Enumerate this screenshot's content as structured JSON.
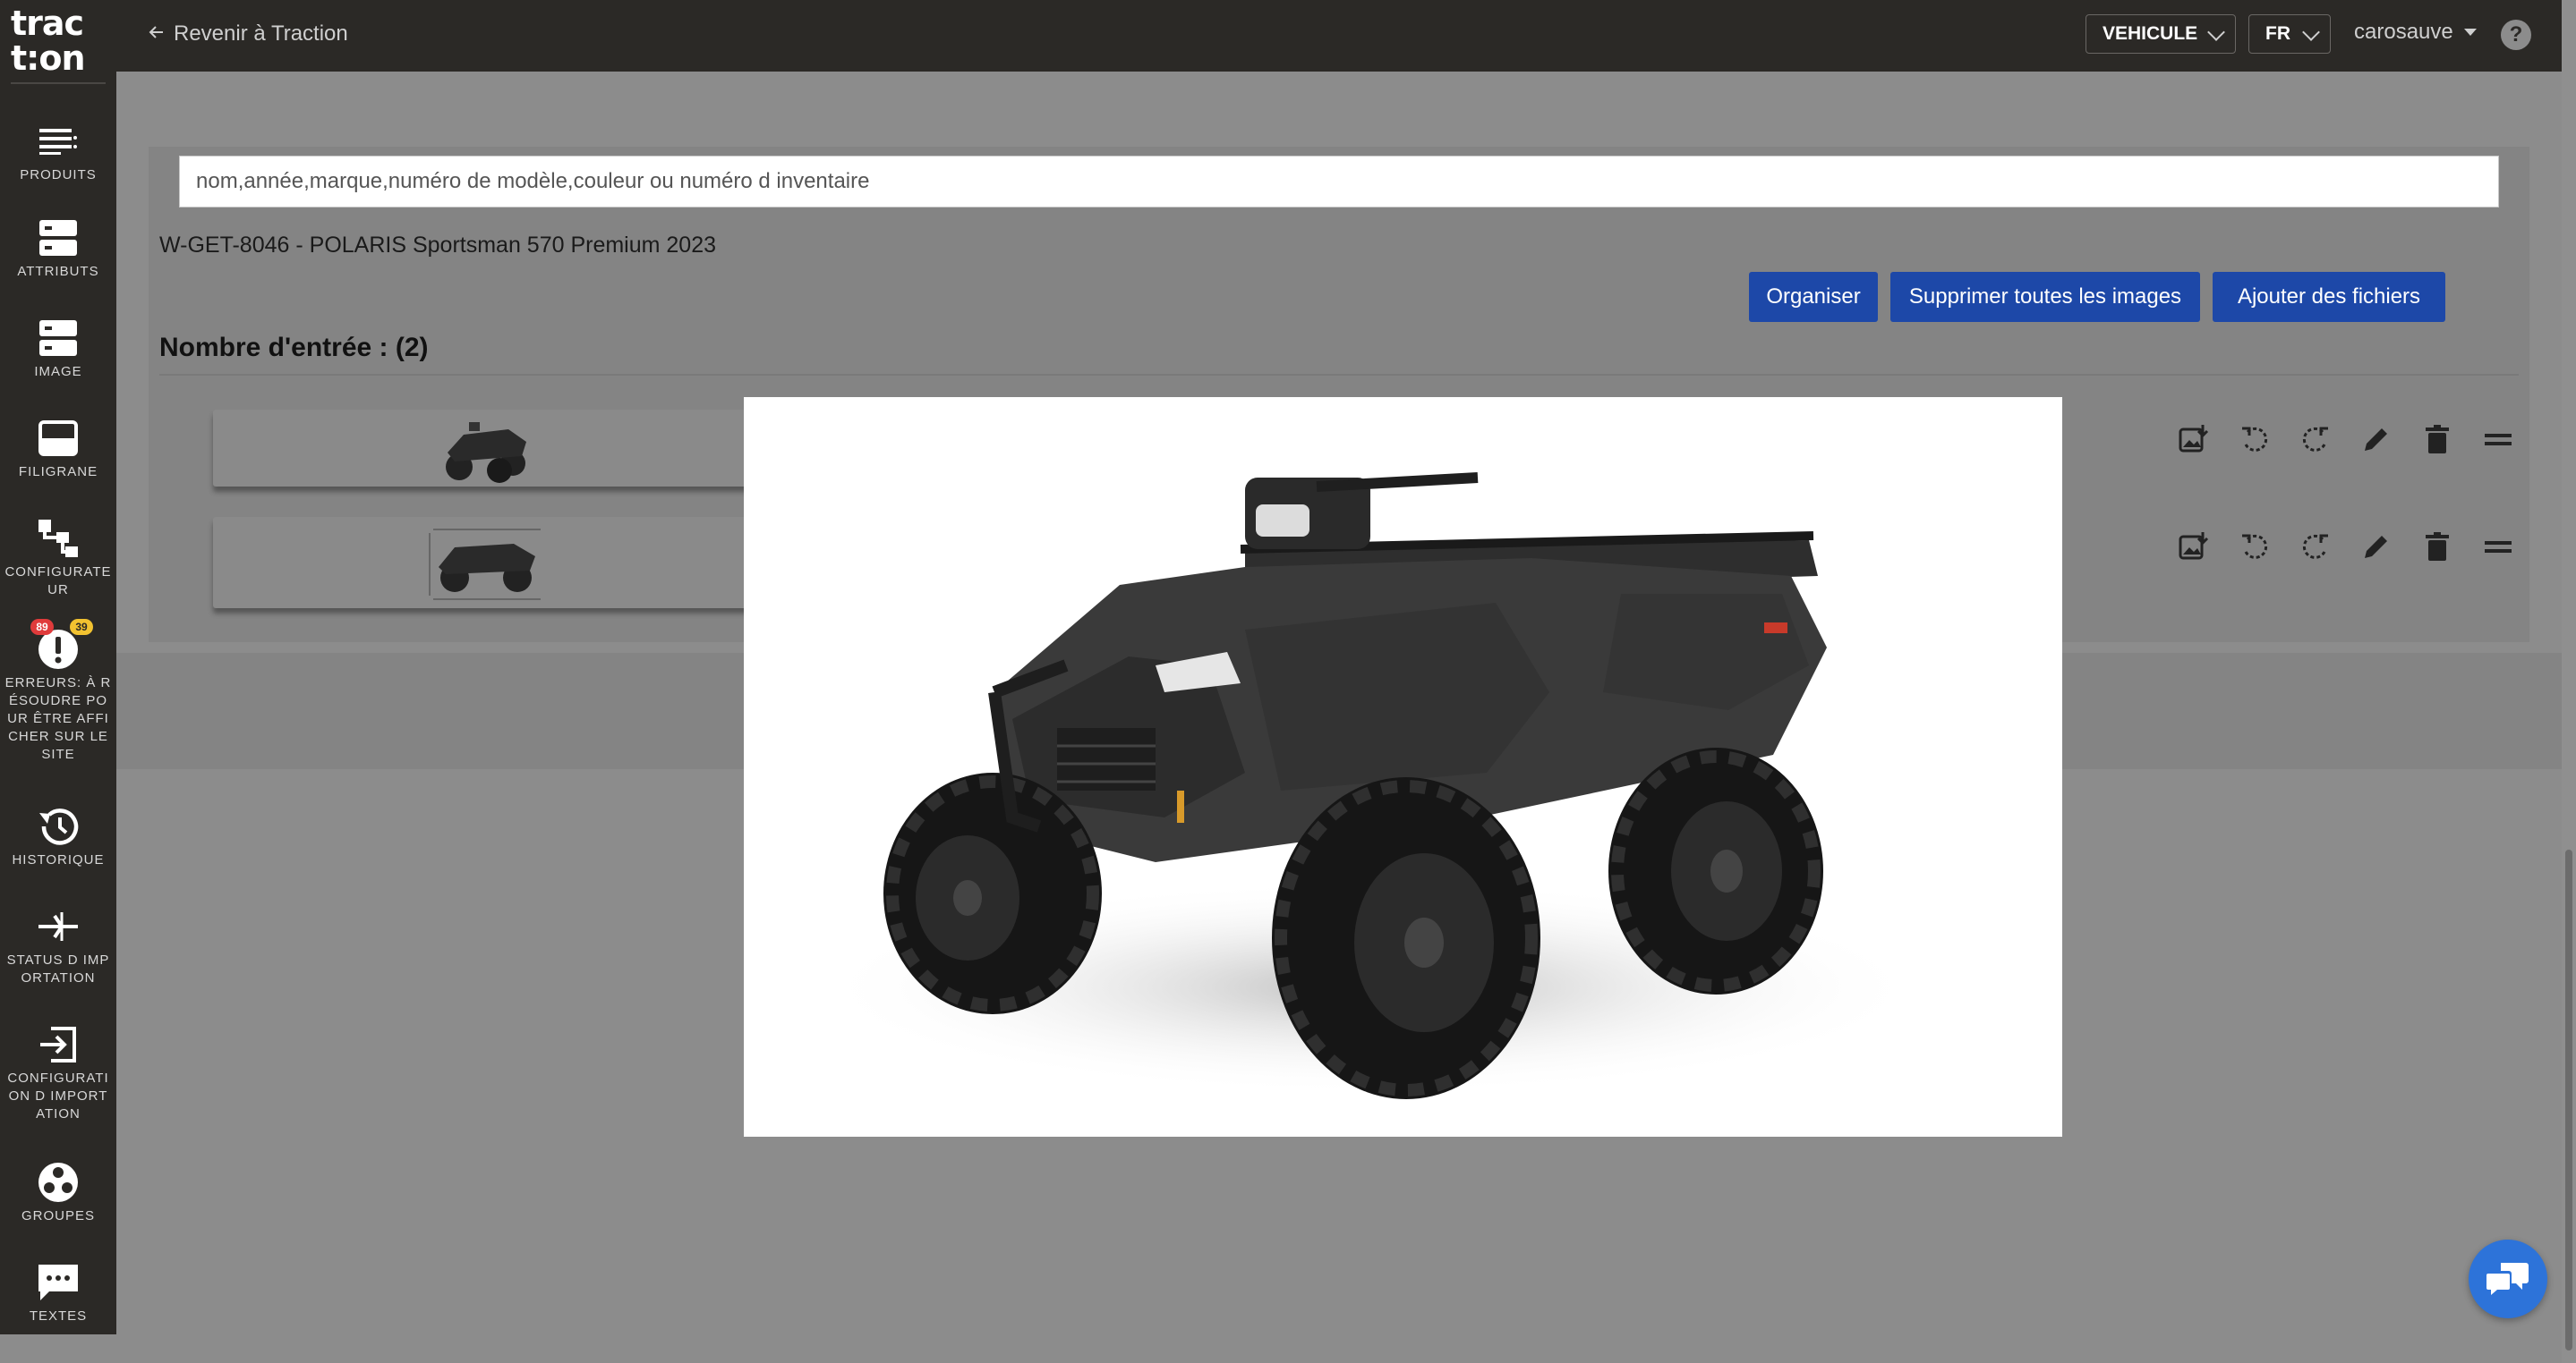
{
  "logo": {
    "line1": "trac",
    "line2": "t:on"
  },
  "sidebar": {
    "items": [
      {
        "id": "produits",
        "label": "PRODUITS",
        "icon": "list-icon"
      },
      {
        "id": "attributs",
        "label": "ATTRIBUTS",
        "icon": "server-icon"
      },
      {
        "id": "image",
        "label": "IMAGE",
        "icon": "server-icon"
      },
      {
        "id": "filigrane",
        "label": "FILIGRANE",
        "icon": "watermark-icon"
      },
      {
        "id": "configurateur",
        "label": "CONFIGURATEUR",
        "icon": "hierarchy-icon"
      },
      {
        "id": "erreurs",
        "label": "ERREURS: À RÉSOUDRE POUR ÊTRE AFFICHER SUR LE SITE",
        "icon": "alert-icon",
        "badge_red": "89",
        "badge_yellow": "39"
      },
      {
        "id": "historique",
        "label": "HISTORIQUE",
        "icon": "history-icon"
      },
      {
        "id": "status",
        "label": "STATUS D IMPORTATION",
        "icon": "import-status-icon"
      },
      {
        "id": "config-import",
        "label": "CONFIGURATION D IMPORTATION",
        "icon": "login-icon"
      },
      {
        "id": "groupes",
        "label": "GROUPES",
        "icon": "groups-icon"
      },
      {
        "id": "textes",
        "label": "TEXTES",
        "icon": "chat-text-icon"
      }
    ]
  },
  "topbar": {
    "back_label": "Revenir à Traction",
    "type_select": "VEHICULE",
    "lang_select": "FR",
    "user": "carosauve",
    "help": "?"
  },
  "main": {
    "search_placeholder": "nom,année,marque,numéro de modèle,couleur ou numéro d inventaire",
    "product_title": "W-GET-8046 - POLARIS Sportsman 570 Premium 2023",
    "buttons": {
      "organise": "Organiser",
      "delete_all": "Supprimer toutes les images",
      "add_files": "Ajouter des fichiers"
    },
    "entries_label": "Nombre d'entrée : (2)"
  },
  "colors": {
    "sidebar_bg": "#2b2926",
    "accent_button": "#1d48a8",
    "chat_bubble": "#2d73d9",
    "badge_red": "#e03b3b",
    "badge_yellow": "#f2c230"
  }
}
